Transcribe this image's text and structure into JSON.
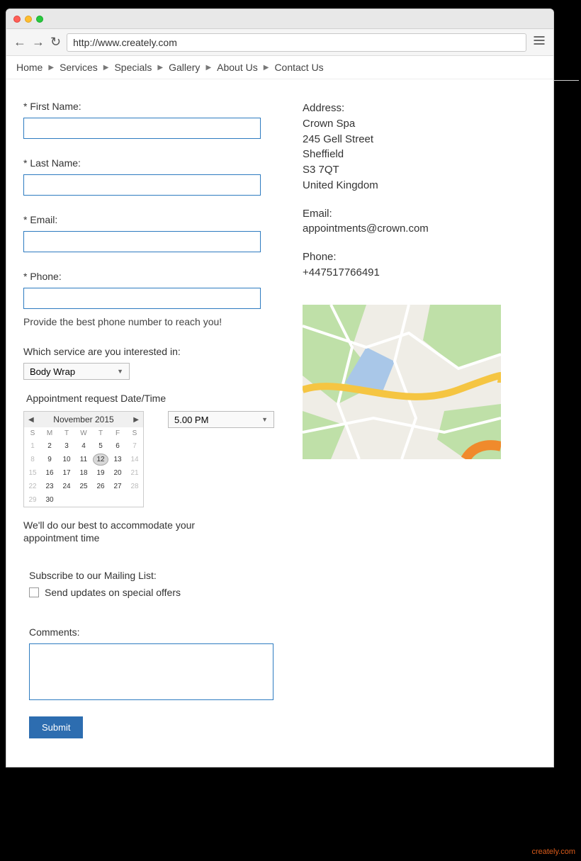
{
  "url": "http://www.creately.com",
  "breadcrumbs": [
    "Home",
    "Services",
    "Specials",
    "Gallery",
    "About Us",
    "Contact Us"
  ],
  "form": {
    "first_name_label": "* First Name:",
    "last_name_label": "* Last Name:",
    "email_label": "* Email:",
    "phone_label": "* Phone:",
    "phone_hint": "Provide the best phone number to reach you!",
    "service_label": "Which service are you interested in:",
    "service_value": "Body Wrap",
    "appt_label": "Appointment request Date/Time",
    "appt_time_value": "5.00 PM",
    "appt_note": "We'll do our best to accommodate your appointment time",
    "subscribe_label": "Subscribe to our Mailing List:",
    "checkbox_label": "Send updates on special offers",
    "comments_label": "Comments:",
    "submit_label": "Submit"
  },
  "calendar": {
    "title": "November 2015",
    "dow": [
      "S",
      "M",
      "T",
      "W",
      "T",
      "F",
      "S"
    ],
    "rows": [
      [
        {
          "d": "1",
          "dim": true
        },
        {
          "d": "2"
        },
        {
          "d": "3"
        },
        {
          "d": "4"
        },
        {
          "d": "5"
        },
        {
          "d": "6"
        },
        {
          "d": "7",
          "dim": true
        }
      ],
      [
        {
          "d": "8",
          "dim": true
        },
        {
          "d": "9"
        },
        {
          "d": "10"
        },
        {
          "d": "11"
        },
        {
          "d": "12",
          "sel": true
        },
        {
          "d": "13"
        },
        {
          "d": "14",
          "dim": true
        }
      ],
      [
        {
          "d": "15",
          "dim": true
        },
        {
          "d": "16"
        },
        {
          "d": "17"
        },
        {
          "d": "18"
        },
        {
          "d": "19"
        },
        {
          "d": "20"
        },
        {
          "d": "21",
          "dim": true
        }
      ],
      [
        {
          "d": "22",
          "dim": true
        },
        {
          "d": "23"
        },
        {
          "d": "24"
        },
        {
          "d": "25"
        },
        {
          "d": "26"
        },
        {
          "d": "27"
        },
        {
          "d": "28",
          "dim": true
        }
      ],
      [
        {
          "d": "29",
          "dim": true
        },
        {
          "d": "30"
        },
        {
          "d": ""
        },
        {
          "d": ""
        },
        {
          "d": ""
        },
        {
          "d": ""
        },
        {
          "d": ""
        }
      ]
    ]
  },
  "contact": {
    "address_label": "Address:",
    "address_lines": [
      "Crown Spa",
      "245 Gell Street",
      "Sheffield",
      "S3 7QT",
      "United Kingdom"
    ],
    "email_label": "Email:",
    "email_value": "appointments@crown.com",
    "phone_label": "Phone:",
    "phone_value": "+447517766491"
  }
}
